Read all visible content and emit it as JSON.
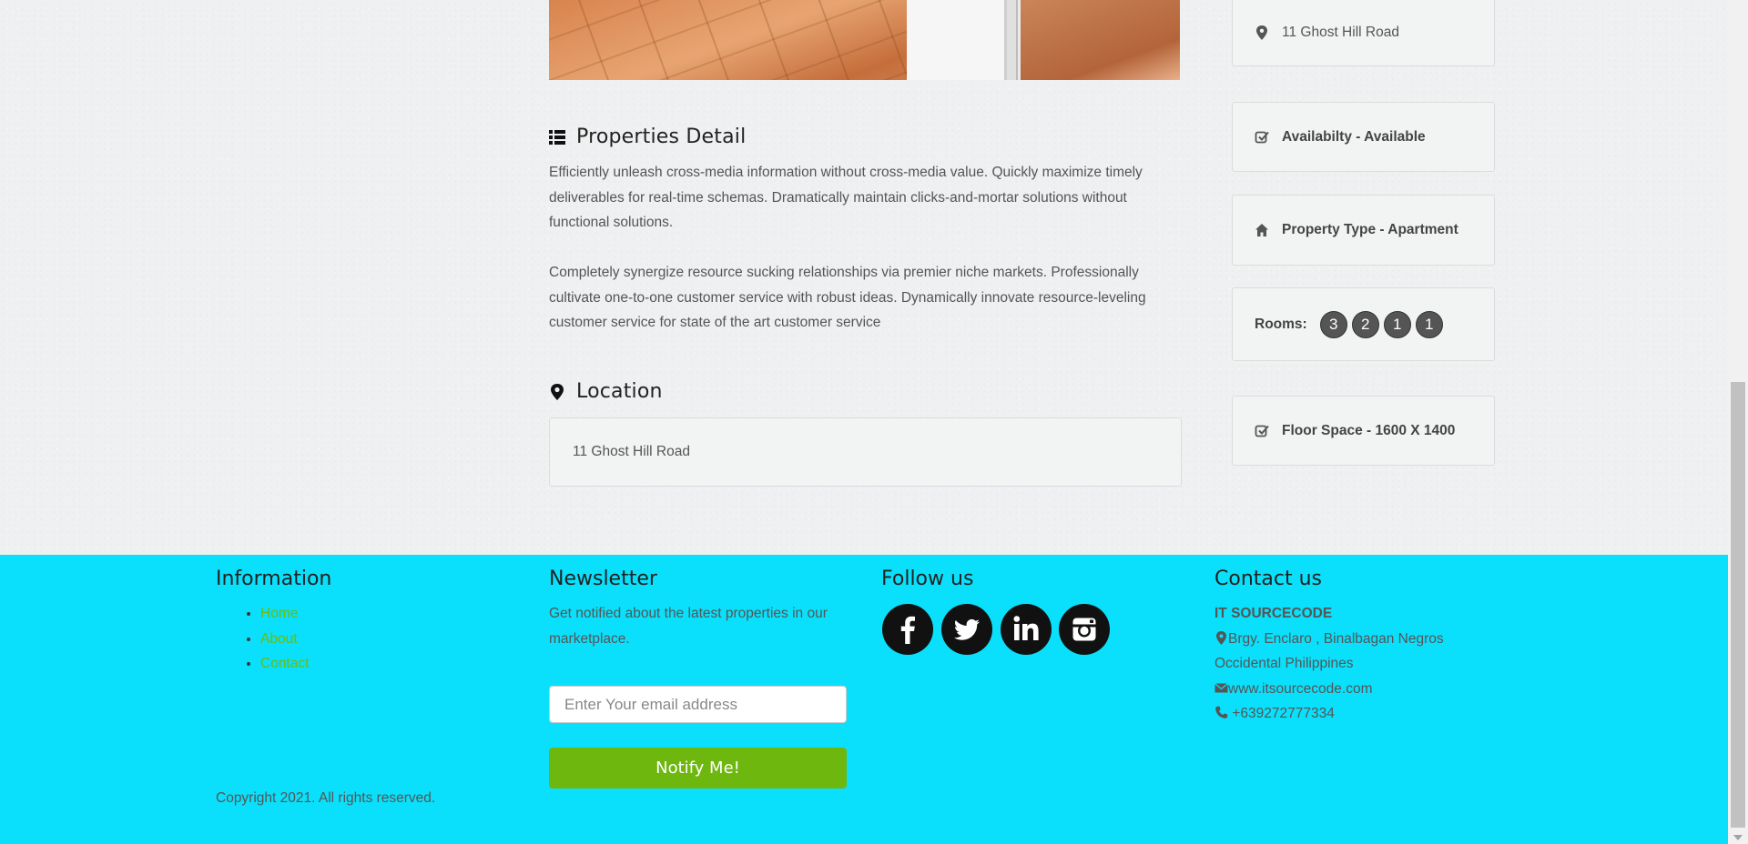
{
  "details": {
    "title": "Properties Detail",
    "paragraph_1": "Efficiently unleash cross-media information without cross-media value. Quickly maximize timely deliverables for real-time schemas. Dramatically maintain clicks-and-mortar solutions without functional solutions.",
    "paragraph_2": "Completely synergize resource sucking relationships via premier niche markets. Professionally cultivate one-to-one customer service with robust ideas. Dynamically innovate resource-leveling customer service for state of the art customer service"
  },
  "location": {
    "title": "Location",
    "address": "11 Ghost Hill Road"
  },
  "sidebar": {
    "address": "11 Ghost Hill Road",
    "availability": "Availabilty - Available",
    "property_type": "Property Type - Apartment",
    "rooms_label": "Rooms:",
    "rooms": [
      "3",
      "2",
      "1",
      "1"
    ],
    "floor_space": "Floor Space - 1600 X 1400"
  },
  "footer": {
    "information": {
      "title": "Information",
      "links": [
        "Home",
        "About",
        "Contact"
      ]
    },
    "newsletter": {
      "title": "Newsletter",
      "text": "Get notified about the latest properties in our marketplace.",
      "email_placeholder": "Enter Your email address",
      "button": "Notify Me!"
    },
    "follow": {
      "title": "Follow us",
      "networks": [
        "facebook",
        "twitter",
        "linkedin",
        "instagram"
      ]
    },
    "contact": {
      "title": "Contact us",
      "company": "IT SOURCECODE",
      "address": "Brgy. Enclaro , Binalbagan Negros Occidental Philippines",
      "website": "www.itsourcecode.com",
      "phone": "+639272777334"
    },
    "copyright": "Copyright 2021. All rights reserved."
  },
  "colors": {
    "footer_bg": "#0ae0fb",
    "accent_green": "#6db70e",
    "link_green": "#6cbb0c"
  }
}
